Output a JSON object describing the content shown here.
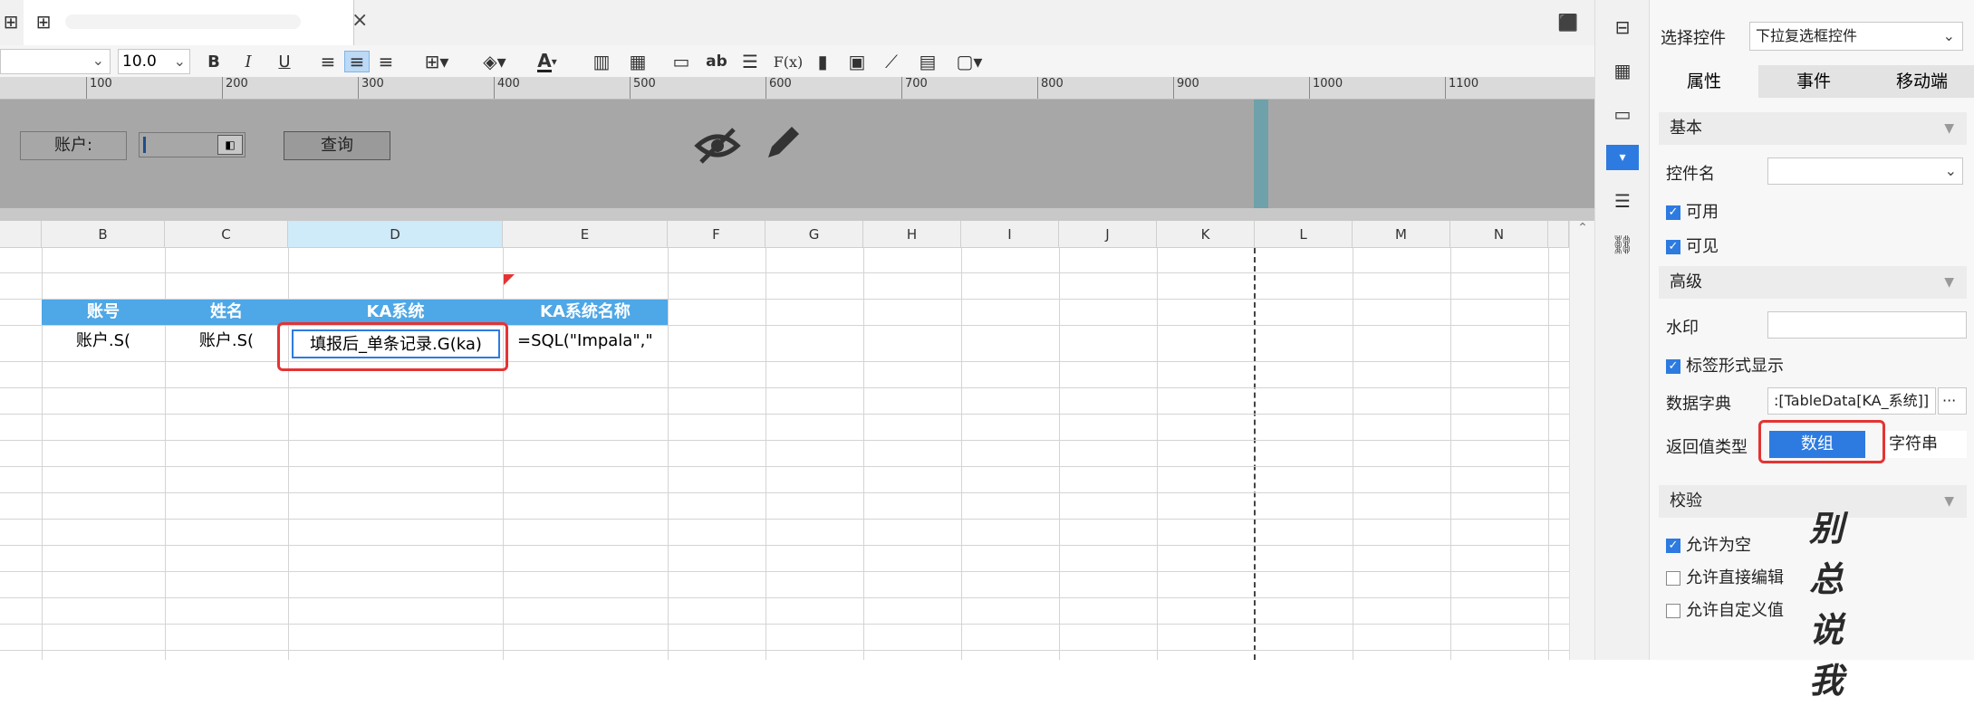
{
  "tabs": {
    "close_glyph": "×"
  },
  "toolbar": {
    "font_size": "10.0",
    "bold": "B",
    "italic": "I",
    "underline": "U",
    "font_color": "A",
    "ab": "ab",
    "fx": "F(x)"
  },
  "ruler": [
    "100",
    "200",
    "300",
    "400",
    "500",
    "600",
    "700",
    "800",
    "900",
    "1000",
    "1100"
  ],
  "param": {
    "account_label": "账户:",
    "query_button": "查询"
  },
  "columns": [
    "B",
    "C",
    "D",
    "E",
    "F",
    "G",
    "H",
    "I",
    "J",
    "K",
    "L",
    "M",
    "N"
  ],
  "table": {
    "headers": [
      "账号",
      "姓名",
      "KA系统",
      "KA系统名称"
    ],
    "row": [
      "账户.S(",
      "账户.S(",
      "填报后_单条记录.G(ka)",
      "=SQL(\"Impala\",\""
    ]
  },
  "panel": {
    "select_control_label": "选择控件",
    "select_control_value": "下拉复选框控件",
    "tabs": [
      "属性",
      "事件",
      "移动端"
    ],
    "basic": "基本",
    "control_name": "控件名",
    "enabled": "可用",
    "visible": "可见",
    "advanced": "高级",
    "watermark": "水印",
    "tag_display": "标签形式显示",
    "data_dict": "数据字典",
    "data_dict_value": ":[TableData[KA_系统]]",
    "return_type": "返回值类型",
    "return_array": "数组",
    "return_string": "字符串",
    "validation": "校验",
    "allow_empty": "允许为空",
    "allow_edit": "允许直接编辑",
    "allow_custom": "允许自定义值",
    "more": "···"
  },
  "watermark_text": "别总说我"
}
